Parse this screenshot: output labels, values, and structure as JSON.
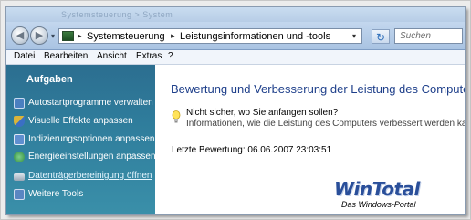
{
  "window": {
    "faded_title": "Systemsteuerung  >  System"
  },
  "nav": {
    "back_glyph": "◀",
    "forward_glyph": "▶",
    "dropdown_glyph": "▾"
  },
  "address": {
    "separator": "▸",
    "crumbs": [
      "Systemsteuerung",
      "Leistungsinformationen und -tools"
    ],
    "dropdown_glyph": "▾"
  },
  "toolbar": {
    "refresh_glyph": "↻"
  },
  "search": {
    "placeholder": "Suchen"
  },
  "menu": {
    "items": [
      "Datei",
      "Bearbeiten",
      "Ansicht",
      "Extras",
      "?"
    ]
  },
  "sidebar": {
    "heading": "Aufgaben",
    "items": [
      {
        "label": "Autostartprogramme verwalten",
        "icon": "startup-programs-icon",
        "color": "#4a7fc0"
      },
      {
        "label": "Visuelle Effekte anpassen",
        "icon": "shield-icon",
        "color": "#d9b43a"
      },
      {
        "label": "Indizierungsoptionen anpassen",
        "icon": "indexing-icon",
        "color": "#5f8fcf"
      },
      {
        "label": "Energieeinstellungen anpassen",
        "icon": "power-options-icon",
        "color": "#3a9a4a"
      },
      {
        "label": "Datenträgerbereinigung öffnen",
        "icon": "disk-cleanup-icon",
        "color": "#a7b4c2"
      },
      {
        "label": "Weitere Tools",
        "icon": "tools-icon",
        "color": "#5a86c2"
      }
    ]
  },
  "main": {
    "title": "Bewertung und Verbesserung der Leistung des Computers",
    "tip_title": "Nicht sicher, wo Sie anfangen sollen?",
    "tip_text": "Informationen, wie die Leistung des Computers verbessert werden kann",
    "last_rating_label": "Letzte Bewertung:",
    "last_rating_value": "06.06.2007 23:03:51"
  },
  "logo": {
    "name": "WinTotal",
    "tagline": "Das Windows-Portal"
  },
  "colors": {
    "sidebar_bg": "#2f7d9c",
    "title_blue": "#1e3f8a",
    "logo_blue": "#2a4f9a"
  }
}
